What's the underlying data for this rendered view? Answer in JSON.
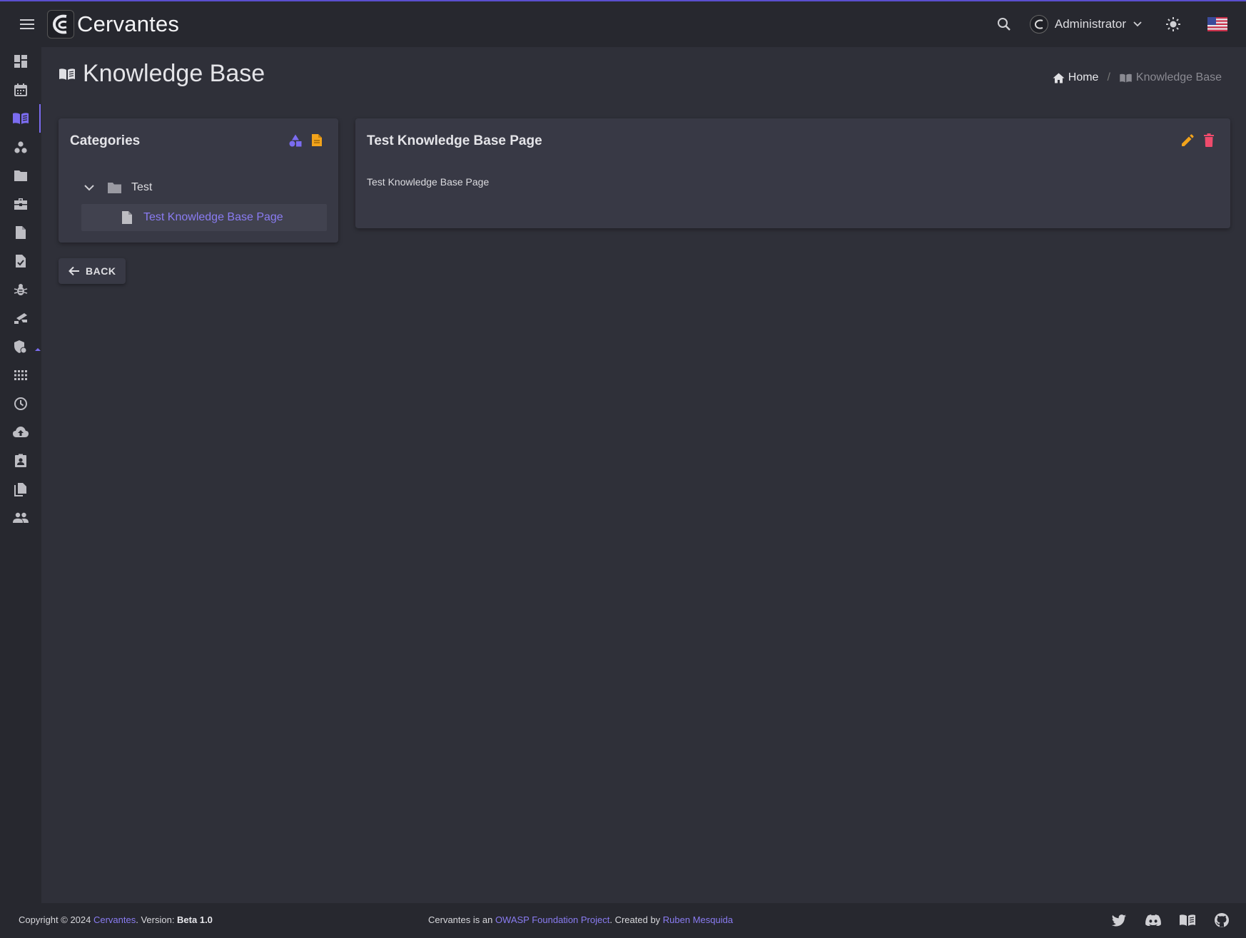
{
  "app": {
    "title": "Cervantes"
  },
  "header": {
    "user_name": "Administrator"
  },
  "page": {
    "title": "Knowledge Base",
    "breadcrumb": {
      "home": "Home",
      "current": "Knowledge Base"
    }
  },
  "categories": {
    "title": "Categories",
    "folder": "Test",
    "page": "Test Knowledge Base Page"
  },
  "article": {
    "title": "Test Knowledge Base Page",
    "body": "Test Knowledge Base Page"
  },
  "back_label": "BACK",
  "footer": {
    "copyright": "Copyright © 2024 ",
    "brand": "Cervantes",
    "version_label": ". Version: ",
    "version": "Beta 1.0",
    "owasp_prefix": "Cervantes is an ",
    "owasp_link": "OWASP Foundation Project",
    "created_by": ". Created by ",
    "author": "Ruben Mesquida"
  },
  "sidebar_icons": [
    "dashboard-icon",
    "calendar-icon",
    "knowledge-base-icon",
    "clients-icon",
    "projects-icon",
    "tasks-icon",
    "documents-icon",
    "checklists-icon",
    "vulns-icon",
    "targets-icon",
    "security-icon",
    "apps-icon",
    "history-icon",
    "upload-icon",
    "reports-icon",
    "templates-icon",
    "users-icon"
  ],
  "colors": {
    "accent": "#7b6cf0",
    "edit": "#f2a31b",
    "delete": "#ef4b6c",
    "folder": "#9a9aa2"
  }
}
